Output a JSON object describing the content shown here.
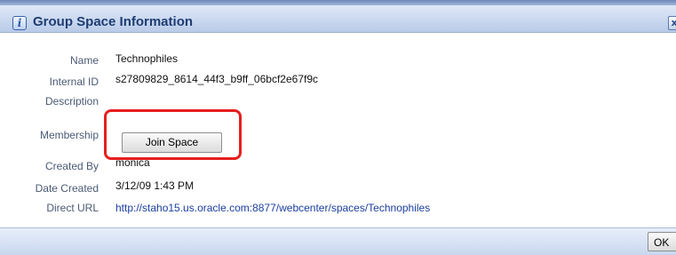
{
  "dialog": {
    "title": "Group Space Information",
    "close_glyph": "x",
    "info_glyph": "i"
  },
  "fields": {
    "name": {
      "label": "Name",
      "value": "Technophiles"
    },
    "internal_id": {
      "label": "Internal ID",
      "value": "s27809829_8614_44f3_b9ff_06bcf2e67f9c"
    },
    "description": {
      "label": "Description",
      "value": ""
    },
    "membership": {
      "label": "Membership",
      "button_label": "Join Space"
    },
    "created_by": {
      "label": "Created By",
      "value": "monica"
    },
    "date_created": {
      "label": "Date Created",
      "value": "3/12/09 1:43 PM"
    },
    "direct_url": {
      "label": "Direct URL",
      "value": "http://staho15.us.oracle.com:8877/webcenter/spaces/Technophiles"
    }
  },
  "footer": {
    "ok_label": "OK"
  },
  "colors": {
    "highlight": "#e61e1e",
    "title_text": "#1e3d73",
    "link": "#1b3ea1"
  }
}
